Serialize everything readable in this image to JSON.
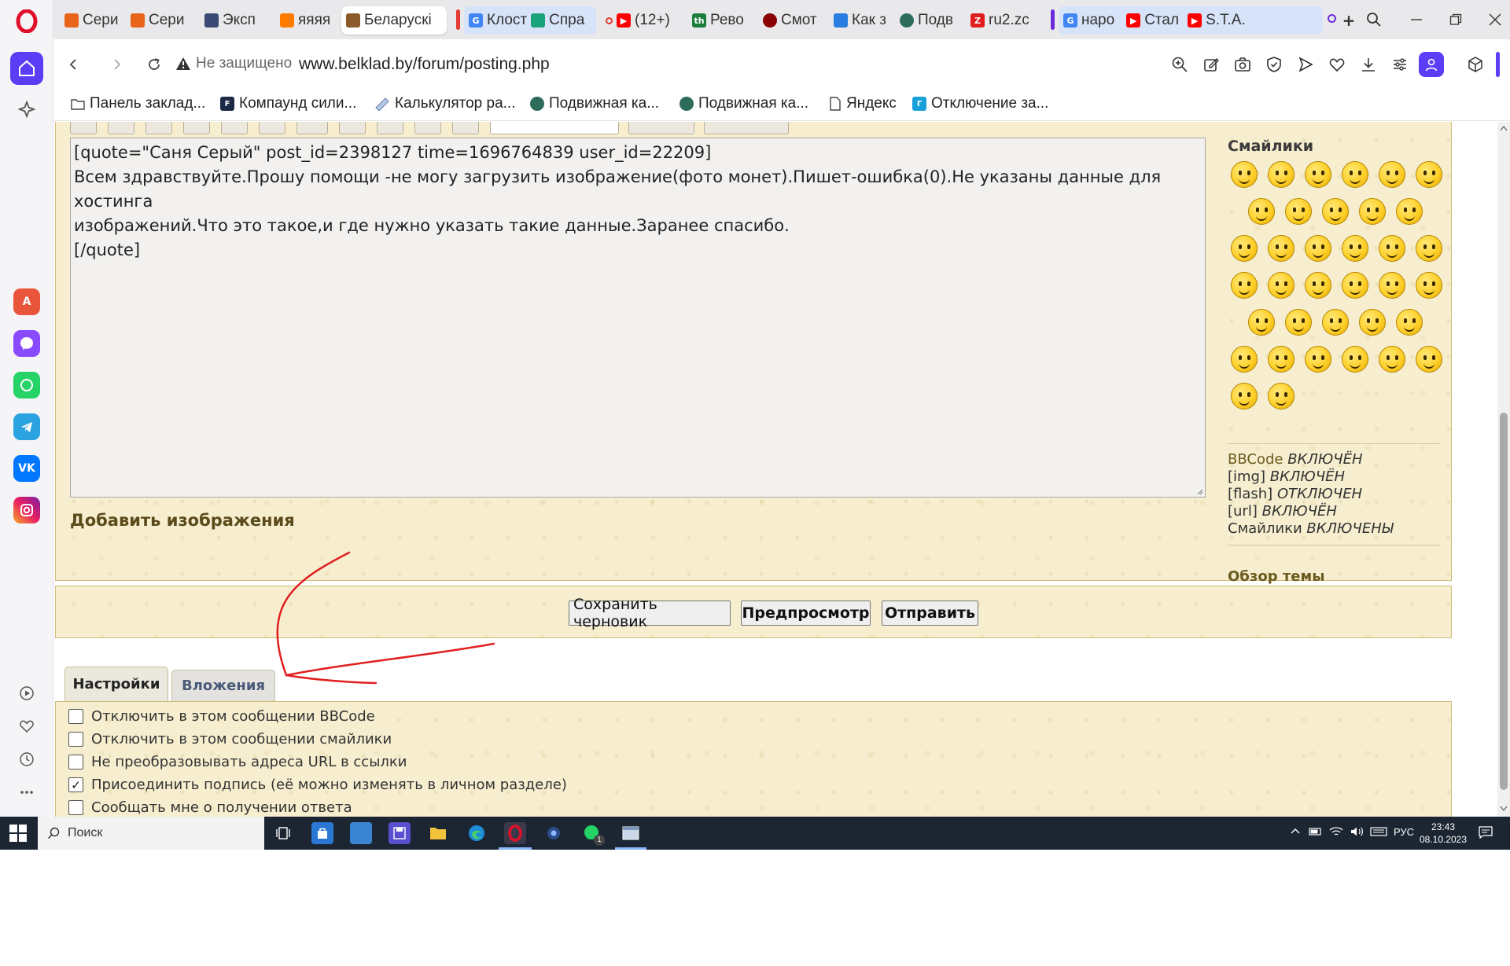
{
  "browser": {
    "tabs": [
      {
        "title": "Сери",
        "color": "#e8641b"
      },
      {
        "title": "Сери",
        "color": "#e8641b"
      },
      {
        "title": "Эксп",
        "color": "#3b4a72"
      },
      {
        "title": "яяяя",
        "color": "#ff7a00"
      },
      {
        "title": "Беларускі",
        "color": "#8b5a2b"
      },
      {
        "title": "Клост",
        "color": "#4285f4"
      },
      {
        "title": "Спра",
        "color": "#1aa37a"
      },
      {
        "title": "(12+)",
        "color": "#ff0000"
      },
      {
        "title": "Рево",
        "color": "#1b7f3b"
      },
      {
        "title": "Смот",
        "color": "#8b0000"
      },
      {
        "title": "Как з",
        "color": "#2a7de1"
      },
      {
        "title": "Подв",
        "color": "#2d6b5a"
      },
      {
        "title": "ru2.zc",
        "color": "#e01e1e"
      },
      {
        "title": "наро",
        "color": "#4285f4"
      },
      {
        "title": "Стал",
        "color": "#ff0000"
      },
      {
        "title": "S.T.A.",
        "color": "#ff0000"
      }
    ],
    "group_colors": {
      "red": "#e53935",
      "purple": "#6b2bd9"
    },
    "tab_badge_red": "(12+)",
    "fav_letters": {
      "th": "th",
      "ru2": "Z"
    },
    "new_tab_label": "+",
    "security_label": "Не защищено",
    "url": "www.belklad.by/forum/posting.php",
    "bookmarks": [
      {
        "label": "Панель заклад...",
        "icon": "folder-icon"
      },
      {
        "label": "Компаунд сили...",
        "icon": "f-site-icon"
      },
      {
        "label": "Калькулятор ра...",
        "icon": "ruler-icon"
      },
      {
        "label": "Подвижная ка...",
        "icon": "globe-icon"
      },
      {
        "label": "Подвижная ка...",
        "icon": "globe-icon"
      },
      {
        "label": "Яндекс",
        "icon": "page-icon"
      },
      {
        "label": "Отключение за...",
        "icon": "g-site-icon"
      }
    ],
    "accent": "#5b3df5"
  },
  "editor": {
    "message_lines": [
      "[quote=\"Саня Серый\" post_id=2398127 time=1696764839 user_id=22209]",
      "Всем здравствуйте.Прошу помощи -не могу загрузить изображение(фото монет).Пишет-ошибка(0).Не указаны данные для хостинга",
      "изображений.Что это такое,и где нужно указать такие данные.Заранее спасибо.",
      "[/quote]"
    ],
    "add_images": "Добавить изображения"
  },
  "smilies": {
    "title": "Смайлики",
    "count": 37
  },
  "bbcode_status": [
    {
      "key": "BBCode",
      "value": "ВКЛЮЧЁН"
    },
    {
      "key": "[img]",
      "value": "ВКЛЮЧЁН"
    },
    {
      "key": "[flash]",
      "value": "ОТКЛЮЧЕН"
    },
    {
      "key": "[url]",
      "value": "ВКЛЮЧЁН"
    },
    {
      "key": "Смайлики",
      "value": "ВКЛЮЧЕНЫ"
    }
  ],
  "topic_review": "Обзор темы",
  "buttons": {
    "save_draft": "Сохранить черновик",
    "preview": "Предпросмотр",
    "submit": "Отправить"
  },
  "form_tabs": {
    "settings": "Настройки",
    "attachments": "Вложения"
  },
  "options": [
    {
      "label": "Отключить в этом сообщении BBCode",
      "checked": false
    },
    {
      "label": "Отключить в этом сообщении смайлики",
      "checked": false
    },
    {
      "label": "Не преобразовывать адреса URL в ссылки",
      "checked": false
    },
    {
      "label": "Присоединить подпись (её можно изменять в личном разделе)",
      "checked": true
    },
    {
      "label": "Сообщать мне о получении ответа",
      "checked": false
    }
  ],
  "checkmark": "✓",
  "annotation_color": "#e02020",
  "taskbar": {
    "search_placeholder": "Поиск",
    "lang": "РУС",
    "time": "23:43",
    "date": "08.10.2023",
    "whatsapp_badge": "1"
  }
}
